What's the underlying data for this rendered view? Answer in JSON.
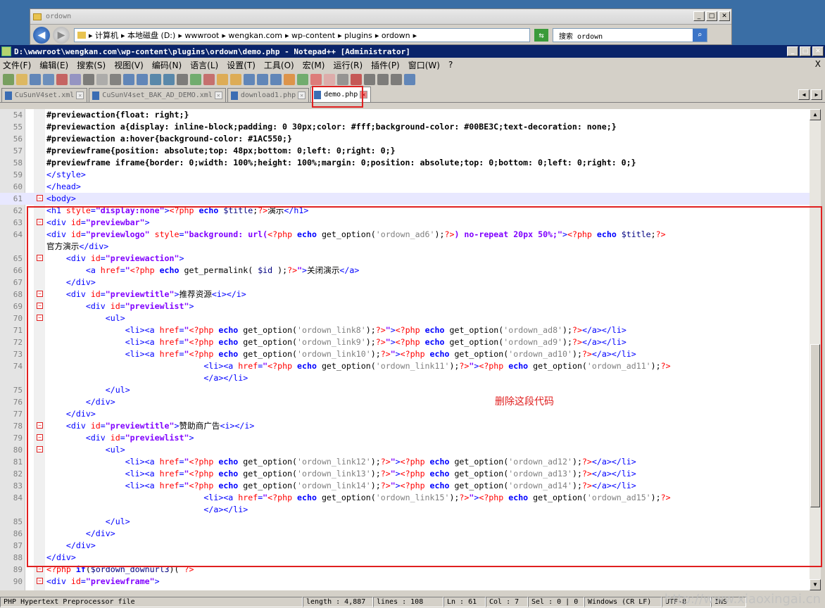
{
  "explorer": {
    "title": "ordown",
    "address_crumbs": [
      "▸ 计算机",
      "▸ 本地磁盘 (D:)",
      "▸ wwwroot",
      "▸ wengkan.com",
      "▸ wp-content",
      "▸ plugins",
      "▸ ordown",
      "▸"
    ],
    "search_placeholder": "搜索 ordown"
  },
  "npp": {
    "title": "D:\\wwwroot\\wengkan.com\\wp-content\\plugins\\ordown\\demo.php - Notepad++ [Administrator]",
    "menu": [
      "文件(F)",
      "编辑(E)",
      "搜索(S)",
      "视图(V)",
      "编码(N)",
      "语言(L)",
      "设置(T)",
      "工具(O)",
      "宏(M)",
      "运行(R)",
      "插件(P)",
      "窗口(W)",
      "?"
    ],
    "menu_close": "X",
    "tabs": [
      "CuSunV4set.xml",
      "CuSunV4set_BAK_AD_DEMO.xml",
      "download1.php",
      "demo.php"
    ],
    "active_tab": 3,
    "annotation": "删除这段代码",
    "status": {
      "filetype": "PHP Hypertext Preprocessor file",
      "length": "length : 4,887",
      "lines": "lines : 108",
      "ln": "Ln : 61",
      "col": "Col : 7",
      "sel": "Sel : 0 | 0",
      "eol": "Windows (CR LF)",
      "enc": "UTF-8",
      "ins": "INS"
    },
    "watermark": "http://www.xiaoxingai.cn"
  },
  "colors": {
    "accent_red": "#e02020",
    "title_bar": "#0a246a"
  },
  "lines": [
    {
      "n": "54",
      "t": "#previewaction{float: right;}"
    },
    {
      "n": "55",
      "t": "#previewaction a{display: inline-block;padding: 0 30px;color: #fff;background-color: #00BE3C;text-decoration: none;}"
    },
    {
      "n": "56",
      "t": "#previewaction a:hover{background-color: #1AC550;}"
    },
    {
      "n": "57",
      "t": "#previewframe{position: absolute;top: 48px;bottom: 0;left: 0;right: 0;}"
    },
    {
      "n": "58",
      "t": "#previewframe iframe{border: 0;width: 100%;height: 100%;margin: 0;position: absolute;top: 0;bottom: 0;left: 0;right: 0;}"
    },
    {
      "n": "59",
      "t": "</style>"
    },
    {
      "n": "60",
      "t": "</head>"
    },
    {
      "n": "61",
      "t": "<body>"
    },
    {
      "n": "62",
      "t": "<h1 style=\"display:none\"><?php echo $title;?>演示</h1>"
    },
    {
      "n": "63",
      "t": "<div id=\"previewbar\">"
    },
    {
      "n": "64",
      "t": "<div id=\"previewlogo\" style=\"background: url(<?php echo get_option('ordown_ad6');?>) no-repeat 20px 50%;\"><?php echo $title;?>"
    },
    {
      "n": "",
      "t": "官方演示</div>"
    },
    {
      "n": "65",
      "t": "    <div id=\"previewaction\">"
    },
    {
      "n": "66",
      "t": "        <a href=\"<?php echo get_permalink( $id );?>\">关闭演示</a>"
    },
    {
      "n": "67",
      "t": "    </div>"
    },
    {
      "n": "68",
      "t": "    <div id=\"previewtitle\">推荐资源<i></i>"
    },
    {
      "n": "69",
      "t": "        <div id=\"previewlist\">"
    },
    {
      "n": "70",
      "t": "            <ul>"
    },
    {
      "n": "71",
      "t": "                <li><a href=\"<?php echo get_option('ordown_link8');?>\"><?php echo get_option('ordown_ad8');?></a></li>"
    },
    {
      "n": "72",
      "t": "                <li><a href=\"<?php echo get_option('ordown_link9');?>\"><?php echo get_option('ordown_ad9');?></a></li>"
    },
    {
      "n": "73",
      "t": "                <li><a href=\"<?php echo get_option('ordown_link10');?>\"><?php echo get_option('ordown_ad10');?></a></li>"
    },
    {
      "n": "74",
      "t": "                                <li><a href=\"<?php echo get_option('ordown_link11');?>\"><?php echo get_option('ordown_ad11');?>"
    },
    {
      "n": "",
      "t": "                                </a></li>"
    },
    {
      "n": "75",
      "t": "            </ul>"
    },
    {
      "n": "76",
      "t": "        </div>"
    },
    {
      "n": "77",
      "t": "    </div>"
    },
    {
      "n": "78",
      "t": "    <div id=\"previewtitle\">赞助商广告<i></i>"
    },
    {
      "n": "79",
      "t": "        <div id=\"previewlist\">"
    },
    {
      "n": "80",
      "t": "            <ul>"
    },
    {
      "n": "81",
      "t": "                <li><a href=\"<?php echo get_option('ordown_link12');?>\"><?php echo get_option('ordown_ad12');?></a></li>"
    },
    {
      "n": "82",
      "t": "                <li><a href=\"<?php echo get_option('ordown_link13');?>\"><?php echo get_option('ordown_ad13');?></a></li>"
    },
    {
      "n": "83",
      "t": "                <li><a href=\"<?php echo get_option('ordown_link14');?>\"><?php echo get_option('ordown_ad14');?></a></li>"
    },
    {
      "n": "84",
      "t": "                                <li><a href=\"<?php echo get_option('ordown_link15');?>\"><?php echo get_option('ordown_ad15');?>"
    },
    {
      "n": "",
      "t": "                                </a></li>"
    },
    {
      "n": "85",
      "t": "            </ul>"
    },
    {
      "n": "86",
      "t": "        </div>"
    },
    {
      "n": "87",
      "t": "    </div>"
    },
    {
      "n": "88",
      "t": "</div>"
    },
    {
      "n": "89",
      "t": "<?php if($ordown_downurl3)( ?>"
    },
    {
      "n": "90",
      "t": "<div id=\"previewframe\">"
    }
  ]
}
